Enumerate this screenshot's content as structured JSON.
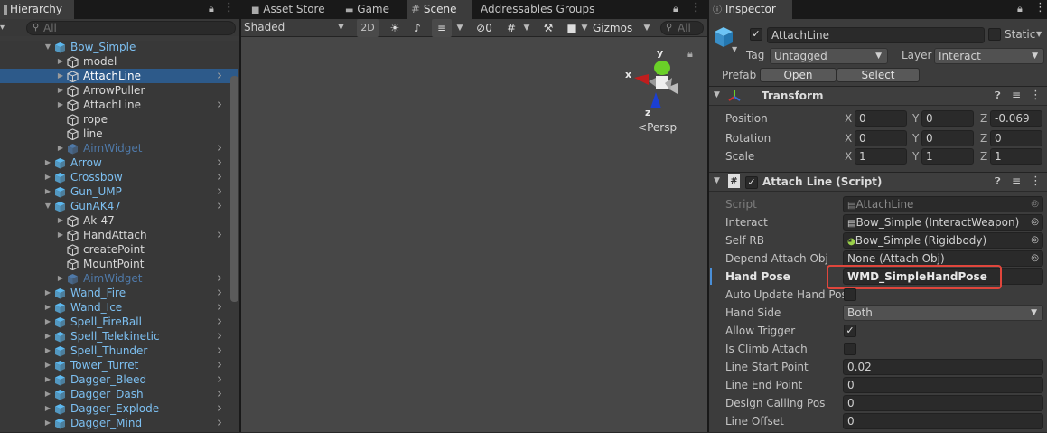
{
  "hierarchy": {
    "tab": "Hierarchy",
    "search_placeholder": "All",
    "rows": [
      {
        "label": "Bow_Simple",
        "style": "blue"
      },
      {
        "label": "model",
        "style": "white"
      },
      {
        "label": "AttachLine",
        "style": "white"
      },
      {
        "label": "ArrowPuller",
        "style": "white"
      },
      {
        "label": "AttachLine",
        "style": "white"
      },
      {
        "label": "rope",
        "style": "white"
      },
      {
        "label": "line",
        "style": "white"
      },
      {
        "label": "AimWidget",
        "style": "dim"
      },
      {
        "label": "Arrow",
        "style": "blue"
      },
      {
        "label": "Crossbow",
        "style": "blue"
      },
      {
        "label": "Gun_UMP",
        "style": "blue"
      },
      {
        "label": "GunAK47",
        "style": "blue"
      },
      {
        "label": "Ak-47",
        "style": "white"
      },
      {
        "label": "HandAttach",
        "style": "white"
      },
      {
        "label": "createPoint",
        "style": "white"
      },
      {
        "label": "MountPoint",
        "style": "white"
      },
      {
        "label": "AimWidget",
        "style": "dim"
      },
      {
        "label": "Wand_Fire",
        "style": "blue"
      },
      {
        "label": "Wand_Ice",
        "style": "blue"
      },
      {
        "label": "Spell_FireBall",
        "style": "blue"
      },
      {
        "label": "Spell_Telekinetic",
        "style": "blue"
      },
      {
        "label": "Spell_Thunder",
        "style": "blue"
      },
      {
        "label": "Tower_Turret",
        "style": "blue"
      },
      {
        "label": "Dagger_Bleed",
        "style": "blue"
      },
      {
        "label": "Dagger_Dash",
        "style": "blue"
      },
      {
        "label": "Dagger_Explode",
        "style": "blue"
      },
      {
        "label": "Dagger_Mind",
        "style": "blue"
      }
    ]
  },
  "scene": {
    "tabs": [
      "Asset Store",
      "Game",
      "Scene",
      "Addressables Groups"
    ],
    "shading_mode": "Shaded",
    "mode_2d": "2D",
    "effects_count": "0",
    "gizmos": "Gizmos",
    "search_placeholder": "All",
    "persp_label": "Persp",
    "axis_x": "x",
    "axis_y": "y",
    "axis_z": "z"
  },
  "inspector": {
    "tab": "Inspector",
    "object_name": "AttachLine",
    "static_label": "Static",
    "tag_label": "Tag",
    "tag_value": "Untagged",
    "layer_label": "Layer",
    "layer_value": "Interact",
    "prefab_label": "Prefab",
    "open_button": "Open",
    "select_button": "Select",
    "transform": {
      "title": "Transform",
      "position_label": "Position",
      "rotation_label": "Rotation",
      "scale_label": "Scale",
      "position": {
        "x": "0",
        "y": "0",
        "z": "-0.069"
      },
      "rotation": {
        "x": "0",
        "y": "0",
        "z": "0"
      },
      "scale": {
        "x": "1",
        "y": "1",
        "z": "1"
      }
    },
    "script": {
      "title": "Attach Line (Script)",
      "fields": {
        "script": {
          "label": "Script",
          "value": "AttachLine"
        },
        "interact": {
          "label": "Interact",
          "value": "Bow_Simple (InteractWeapon)"
        },
        "self_rb": {
          "label": "Self RB",
          "value": "Bow_Simple (Rigidbody)"
        },
        "depend": {
          "label": "Depend Attach Obj",
          "value": "None (Attach Obj)"
        },
        "hand_pose": {
          "label": "Hand Pose",
          "value": "WMD_SimpleHandPose"
        },
        "auto_update": {
          "label": "Auto Update Hand Pose"
        },
        "hand_side": {
          "label": "Hand Side",
          "value": "Both"
        },
        "allow_trigger": {
          "label": "Allow Trigger",
          "checked": true
        },
        "is_climb": {
          "label": "Is Climb Attach",
          "checked": false
        },
        "line_start": {
          "label": "Line Start Point",
          "value": "0.02"
        },
        "line_end": {
          "label": "Line End Point",
          "value": "0"
        },
        "design_calling": {
          "label": "Design Calling Pos",
          "value": "0"
        },
        "line_offset": {
          "label": "Line Offset",
          "value": "0"
        }
      }
    }
  },
  "colors": {
    "highlight_box": "#e0463c",
    "selection": "#2d5a8a",
    "prefab_blue": "#7dc0f2"
  }
}
